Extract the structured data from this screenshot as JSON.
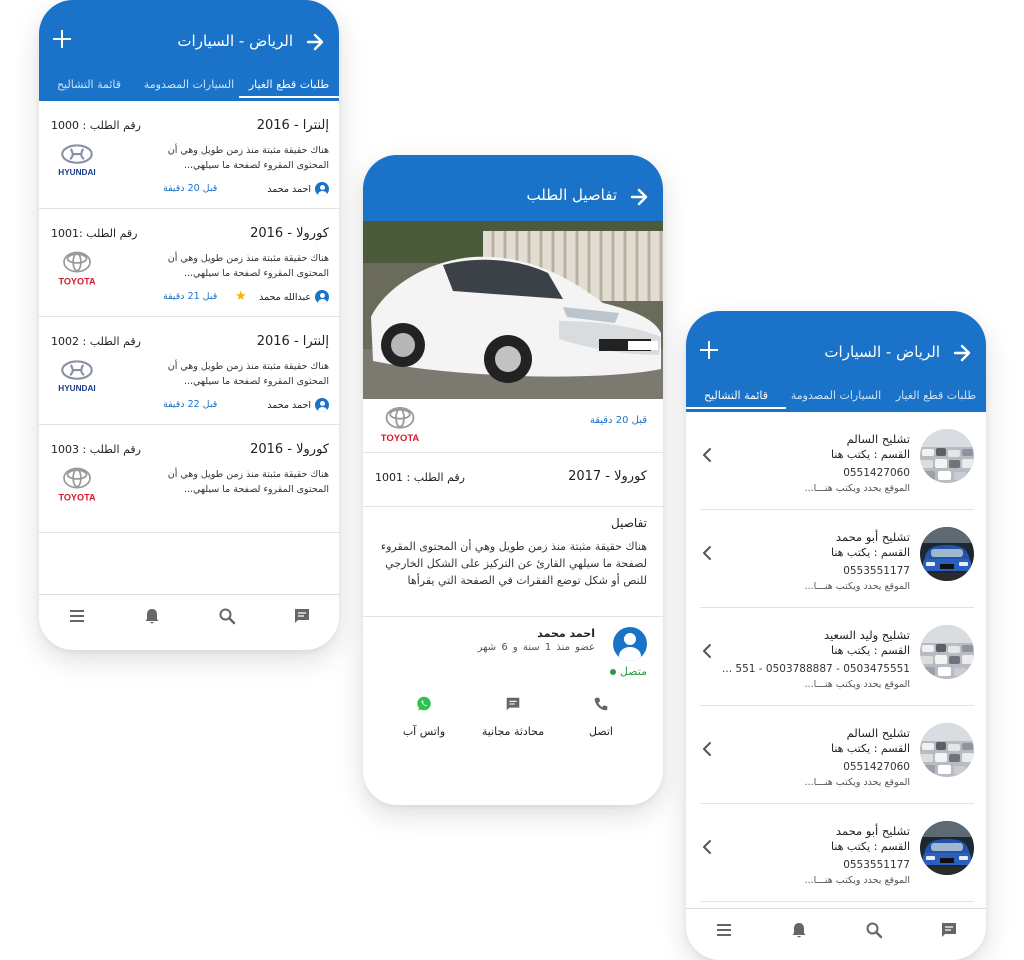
{
  "colors": {
    "primary": "#1a73c8",
    "online": "#2e9a44",
    "star": "#f4b400",
    "toyota_red": "#d7182a",
    "hyundai_blue": "#1e3a8a"
  },
  "list_screen": {
    "title": "الرياض - السيارات",
    "tabs": [
      "طلبات قطع الغيار",
      "السيارات المصدومة",
      "قائمة التشاليح"
    ],
    "requests": [
      {
        "model": "إلنترا - 2016",
        "number": "رقم الطلب : 1000",
        "description": "هناك حقيقة مثبتة منذ زمن طويل وهي أن المحتوى المقروء لصفحة ما سيلهي...",
        "user": "احمد محمد",
        "time": "قبل 20 دقيقة",
        "brand": "HYUNDAI",
        "brand_icon": "hyundai-logo",
        "starred": false
      },
      {
        "model": "كورولا - 2016",
        "number": "رقم الطلب :1001",
        "description": "هناك حقيقة مثبتة منذ زمن طويل وهي أن المحتوى المقروء لصفحة ما سيلهي...",
        "user": "عبدالله محمد",
        "time": "قبل 21 دقيقة",
        "brand": "TOYOTA",
        "brand_icon": "toyota-logo",
        "starred": true
      },
      {
        "model": "إلنترا - 2016",
        "number": "رقم الطلب : 1002",
        "description": "هناك حقيقة مثبتة منذ زمن طويل وهي أن المحتوى المقروء لصفحة ما سيلهي...",
        "user": "احمد محمد",
        "time": "قبل 22 دقيقة",
        "brand": "HYUNDAI",
        "brand_icon": "hyundai-logo",
        "starred": false
      },
      {
        "model": "كورولا - 2016",
        "number": "رقم الطلب : 1003",
        "description": "هناك حقيقة مثبتة منذ زمن طويل وهي أن المحتوى المقروء لصفحة ما سيلهي...",
        "user": "",
        "time": "",
        "brand": "TOYOTA",
        "brand_icon": "toyota-logo",
        "starred": false
      }
    ],
    "bottom_nav": [
      "chat-icon",
      "search-icon",
      "bell-icon",
      "menu-icon"
    ]
  },
  "detail_screen": {
    "title": "تفاصيل الطلب",
    "time": "قبل 20 دقيقة",
    "brand": "TOYOTA",
    "model": "كورولا - 2017",
    "number": "رقم الطلب : 1001",
    "details_heading": "تفاصيل",
    "details_body": "هناك حقيقة مثبتة منذ زمن طويل وهي أن المحتوى المقروء لصفحة ما سيلهي القارئ عن التركيز على الشكل الخارجي للنص أو شكل توضع الفقرات في الصفحة التي يقرأها",
    "person_name": "احمد محمد",
    "member_since": "عضو منذ  1 سنة  و 6 شهر",
    "status": "متصل",
    "actions": [
      {
        "label": "اتصل",
        "icon": "phone-icon"
      },
      {
        "label": "محادثة مجانية",
        "icon": "chat-icon"
      },
      {
        "label": "واتس آب",
        "icon": "whatsapp-icon"
      }
    ]
  },
  "scrap_screen": {
    "title": "الرياض - السيارات",
    "tabs": [
      "طلبات قطع الغيار",
      "السيارات المصدومة",
      "قائمة التشاليح"
    ],
    "shops": [
      {
        "name": "تشليح السالم",
        "department": "القسم : يكتب هنا",
        "phone": "0551427060",
        "location": "الموقع يحدد ويكتب هنـــا..."
      },
      {
        "name": "تشليح أبو محمد",
        "department": "القسم : يكتب هنا",
        "phone": "0553551177",
        "location": "الموقع يحدد ويكتب هنـــا..."
      },
      {
        "name": "تشليح وليد السعيد",
        "department": "القسم : يكتب هنا",
        "phone": "0503475551 - 0503788887 - 551 ...",
        "location": "الموقع يحدد ويكتب هنـــا..."
      },
      {
        "name": "تشليح السالم",
        "department": "القسم : يكتب هنا",
        "phone": "0551427060",
        "location": "الموقع يحدد ويكتب هنـــا..."
      },
      {
        "name": "تشليح أبو محمد",
        "department": "القسم : يكتب هنا",
        "phone": "0553551177",
        "location": "الموقع يحدد ويكتب هنـــا..."
      }
    ],
    "bottom_nav": [
      "chat-icon",
      "search-icon",
      "bell-icon",
      "menu-icon"
    ]
  }
}
